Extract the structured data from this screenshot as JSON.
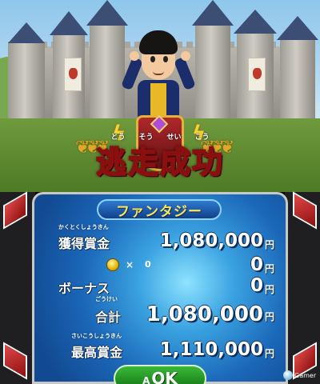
{
  "scene": {
    "title_kanji": "逃走成功",
    "title_furigana": [
      "とう",
      "そう",
      "せい",
      "こう"
    ]
  },
  "results": {
    "header": "ファンタジー",
    "acquired": {
      "ruby": "かくとくしょうきん",
      "label": "獲得賞金",
      "value": "1,080,000",
      "unit": "円"
    },
    "coins": {
      "multiplier": "×",
      "count": "0",
      "value": "0",
      "unit": "円"
    },
    "bonus": {
      "label": "ボーナス",
      "value": "0",
      "unit": "円"
    },
    "total": {
      "ruby": "ごうけい",
      "label": "合計",
      "value": "1,080,000",
      "unit": "円"
    },
    "highest": {
      "ruby": "さいこうしょうきん",
      "label": "最高賞金",
      "value": "1,110,000",
      "unit": "円"
    }
  },
  "ok_button": {
    "a_label": "A",
    "label": "OK"
  },
  "watermark": "Gamer",
  "colors": {
    "header_text": "#f5e85c",
    "ok_green": "#3ab83a",
    "title_stroke": "#8a1010"
  }
}
